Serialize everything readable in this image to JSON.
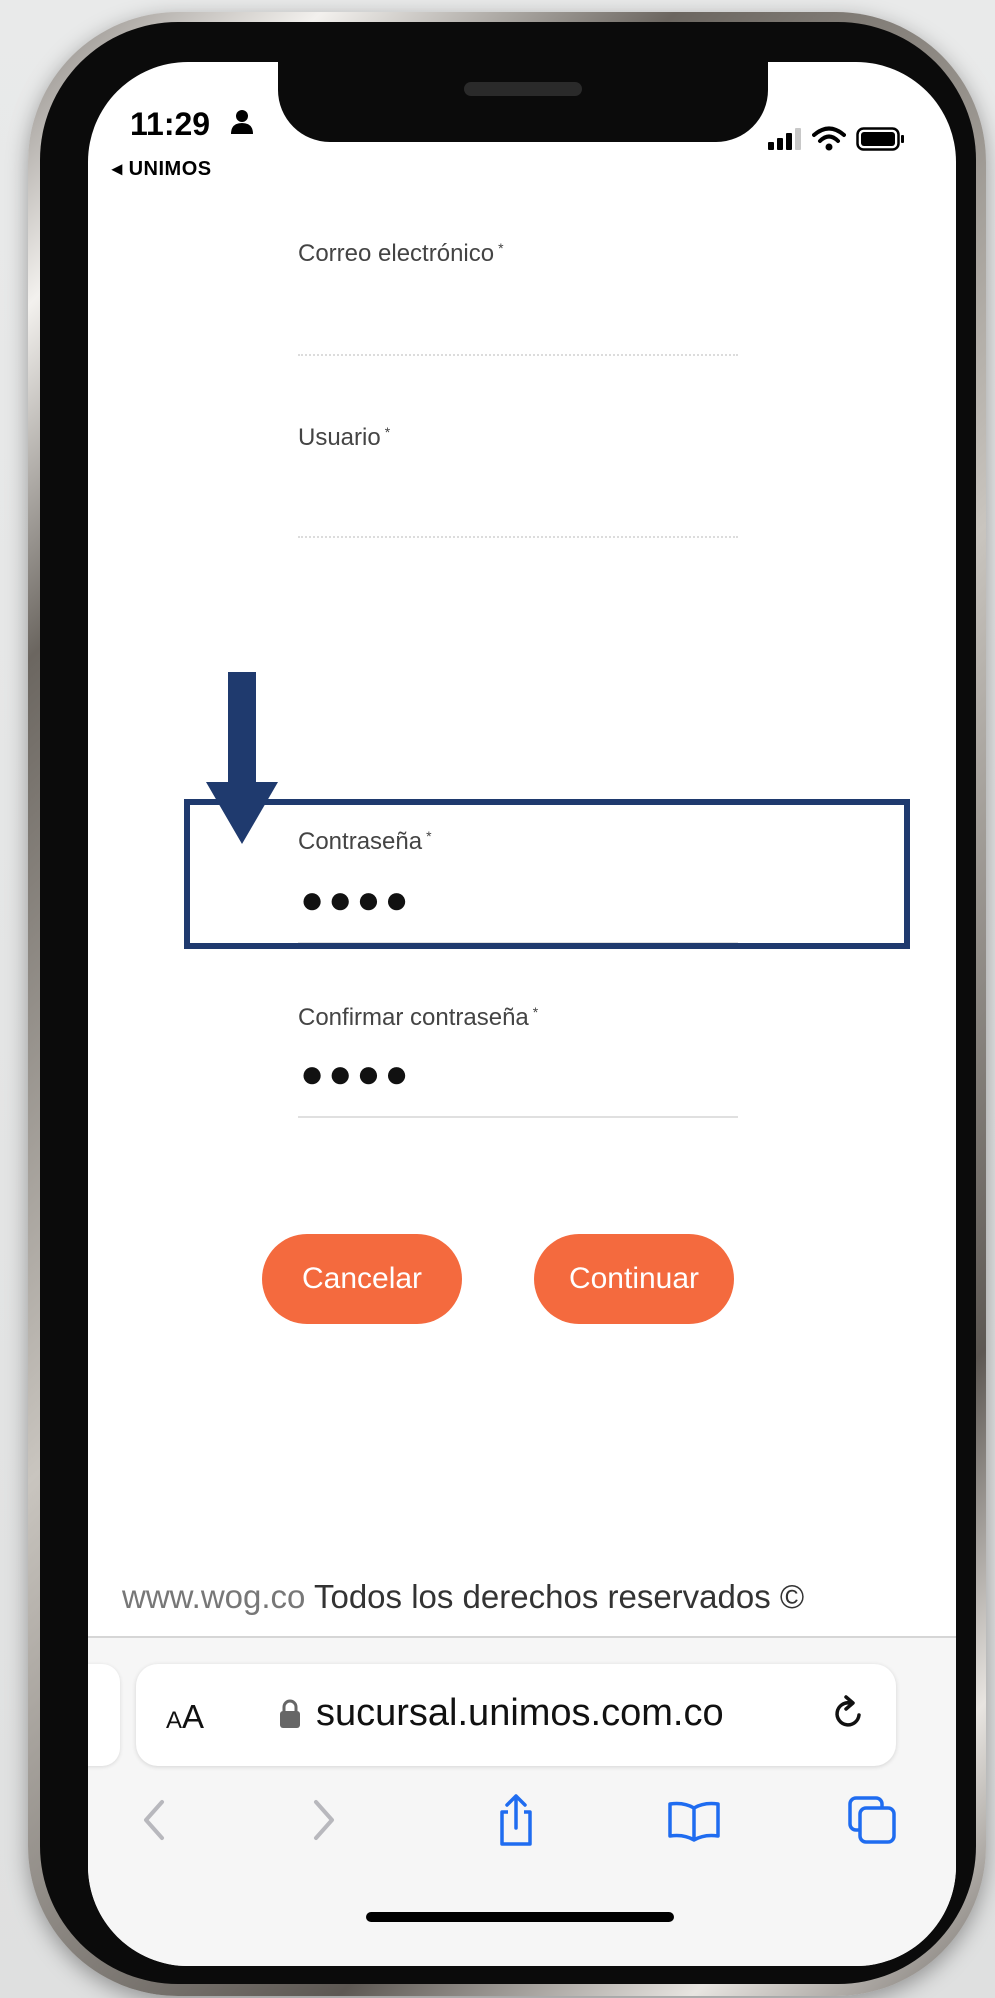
{
  "status_bar": {
    "time": "11:29",
    "back_app": "◂ UNIMOS"
  },
  "form": {
    "email_label": "Correo electrónico",
    "user_label": "Usuario",
    "password_label": "Contraseña",
    "password_value": "●●●●",
    "confirm_label": "Confirmar contraseña",
    "confirm_value": "●●●●",
    "required_mark": "*",
    "cancel_label": "Cancelar",
    "continue_label": "Continuar"
  },
  "footer": {
    "site": "www.wog.co",
    "rights": " Todos los derechos reservados ©"
  },
  "safari": {
    "aa_small": "A",
    "aa_large": "A",
    "url": "sucursal.unimos.com.co"
  },
  "colors": {
    "accent": "#f46a3e",
    "annotation": "#1f3a6e",
    "toolbar_active": "#1f6cf0",
    "toolbar_disabled": "#b8b8bd"
  },
  "icons": {
    "toolbar": [
      "back-icon",
      "forward-icon",
      "share-icon",
      "bookmarks-icon",
      "tabs-icon"
    ]
  }
}
